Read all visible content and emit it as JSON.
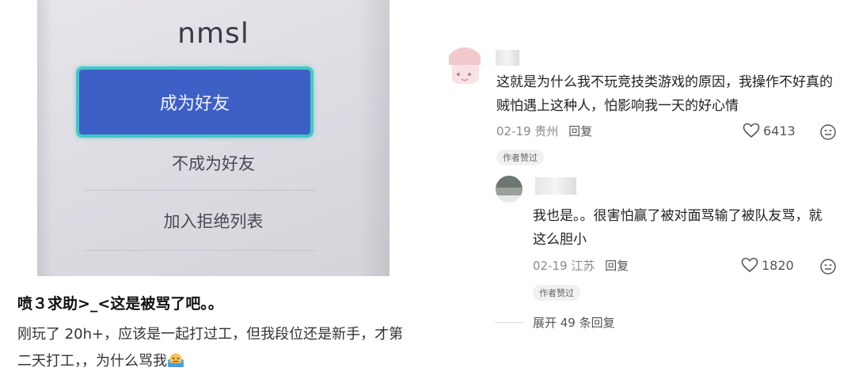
{
  "dialog": {
    "message": "nmsl",
    "primary_button": "成为好友",
    "secondary_button": "不成为好友",
    "tertiary_button": "加入拒绝列表"
  },
  "post": {
    "title": "喷３求助>_<这是被骂了吧。。",
    "body": "刚玩了 20h+，应该是一起打过工，但我段位还是新手，才第二天打工，，为什么骂我"
  },
  "comments": [
    {
      "text": "这就是为什么我不玩竞技类游戏的原因，我操作不好真的贼怕遇上这种人，怕影响我一天的好心情",
      "date": "02-19",
      "location": "贵州",
      "reply_label": "回复",
      "likes": "6413",
      "badge": "作者赞过"
    },
    {
      "text": "我也是。。很害怕赢了被对面骂输了被队友骂，就这么胆小",
      "date": "02-19",
      "location": "江苏",
      "reply_label": "回复",
      "likes": "1820",
      "badge": "作者赞过"
    }
  ],
  "expand_replies": "展开 49 条回复",
  "icons": [
    "heart-icon",
    "more-emoji-icon",
    "crying-emoji-icon"
  ]
}
